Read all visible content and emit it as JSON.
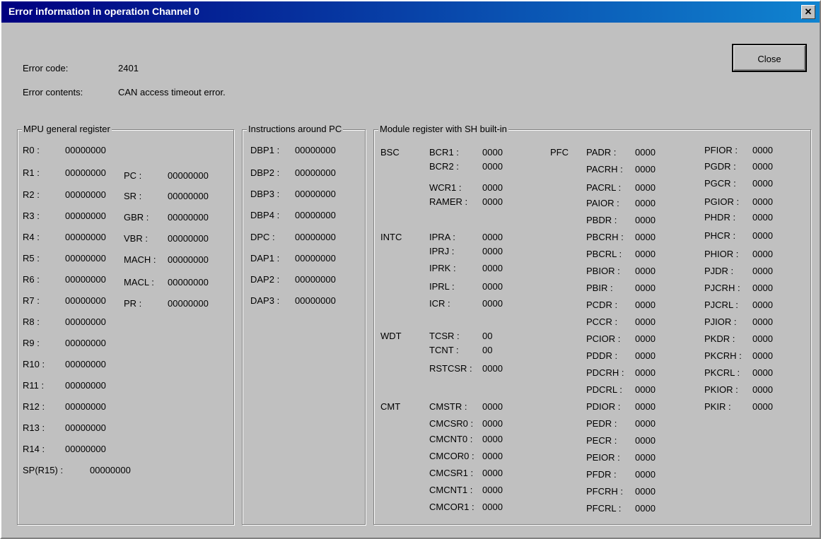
{
  "window": {
    "title": "Error information in operation Channel 0",
    "close_glyph": "✕"
  },
  "header": {
    "error_code_label": "Error code:",
    "error_code_value": "2401",
    "error_contents_label": "Error contents:",
    "error_contents_value": "CAN access timeout error.",
    "close_label": "Close"
  },
  "groups": {
    "mpu": "MPU general register",
    "instructions": "Instructions around PC",
    "module": "Module register with SH built-in"
  },
  "mpu_registers": [
    {
      "name": "R0 :",
      "value": "00000000"
    },
    {
      "name": "R1 :",
      "value": "00000000"
    },
    {
      "name": "R2 :",
      "value": "00000000"
    },
    {
      "name": "R3 :",
      "value": "00000000"
    },
    {
      "name": "R4 :",
      "value": "00000000"
    },
    {
      "name": "R5 :",
      "value": "00000000"
    },
    {
      "name": "R6 :",
      "value": "00000000"
    },
    {
      "name": "R7 :",
      "value": "00000000"
    },
    {
      "name": "R8 :",
      "value": "00000000"
    },
    {
      "name": "R9 :",
      "value": "00000000"
    },
    {
      "name": "R10 :",
      "value": "00000000"
    },
    {
      "name": "R11 :",
      "value": "00000000"
    },
    {
      "name": "R12 :",
      "value": "00000000"
    },
    {
      "name": "R13 :",
      "value": "00000000"
    },
    {
      "name": "R14 :",
      "value": "00000000"
    },
    {
      "name": "SP(R15) :",
      "value": "00000000"
    }
  ],
  "control_registers": [
    {
      "name": "PC :",
      "value": "00000000"
    },
    {
      "name": "SR :",
      "value": "00000000"
    },
    {
      "name": "GBR :",
      "value": "00000000"
    },
    {
      "name": "VBR :",
      "value": "00000000"
    },
    {
      "name": "MACH :",
      "value": "00000000"
    },
    {
      "name": "MACL :",
      "value": "00000000"
    },
    {
      "name": "PR :",
      "value": "00000000"
    }
  ],
  "instructions": [
    {
      "name": "DBP1 :",
      "value": "00000000"
    },
    {
      "name": "DBP2 :",
      "value": "00000000"
    },
    {
      "name": "DBP3 :",
      "value": "00000000"
    },
    {
      "name": "DBP4 :",
      "value": "00000000"
    },
    {
      "name": "DPC :",
      "value": "00000000"
    },
    {
      "name": "DAP1 :",
      "value": "00000000"
    },
    {
      "name": "DAP2 :",
      "value": "00000000"
    },
    {
      "name": "DAP3 :",
      "value": "00000000"
    }
  ],
  "module_sections": [
    "BSC",
    "INTC",
    "WDT",
    "CMT",
    "PFC"
  ],
  "module_col1": [
    {
      "name": "BCR1 :",
      "value": "0000"
    },
    {
      "name": "BCR2 :",
      "value": "0000"
    },
    {
      "name": "WCR1 :",
      "value": "0000"
    },
    {
      "name": "RAMER :",
      "value": "0000"
    },
    {
      "name": "IPRA :",
      "value": "0000"
    },
    {
      "name": "IPRJ :",
      "value": "0000"
    },
    {
      "name": "IPRK :",
      "value": "0000"
    },
    {
      "name": "IPRL :",
      "value": "0000"
    },
    {
      "name": "ICR :",
      "value": "0000"
    },
    {
      "name": "TCSR :",
      "value": "00"
    },
    {
      "name": "TCNT :",
      "value": "00"
    },
    {
      "name": "RSTCSR :",
      "value": "0000"
    },
    {
      "name": "CMSTR :",
      "value": "0000"
    },
    {
      "name": "CMCSR0 :",
      "value": "0000"
    },
    {
      "name": "CMCNT0 :",
      "value": "0000"
    },
    {
      "name": "CMCOR0 :",
      "value": "0000"
    },
    {
      "name": "CMCSR1 :",
      "value": "0000"
    },
    {
      "name": "CMCNT1 :",
      "value": "0000"
    },
    {
      "name": "CMCOR1 :",
      "value": "0000"
    }
  ],
  "module_col2": [
    {
      "name": "PADR :",
      "value": "0000"
    },
    {
      "name": "PACRH :",
      "value": "0000"
    },
    {
      "name": "PACRL :",
      "value": "0000"
    },
    {
      "name": "PAIOR :",
      "value": "0000"
    },
    {
      "name": "PBDR :",
      "value": "0000"
    },
    {
      "name": "PBCRH :",
      "value": "0000"
    },
    {
      "name": "PBCRL :",
      "value": "0000"
    },
    {
      "name": "PBIOR :",
      "value": "0000"
    },
    {
      "name": "PBIR :",
      "value": "0000"
    },
    {
      "name": "PCDR :",
      "value": "0000"
    },
    {
      "name": "PCCR :",
      "value": "0000"
    },
    {
      "name": "PCIOR :",
      "value": "0000"
    },
    {
      "name": "PDDR :",
      "value": "0000"
    },
    {
      "name": "PDCRH :",
      "value": "0000"
    },
    {
      "name": "PDCRL :",
      "value": "0000"
    },
    {
      "name": "PDIOR :",
      "value": "0000"
    },
    {
      "name": "PEDR :",
      "value": "0000"
    },
    {
      "name": "PECR :",
      "value": "0000"
    },
    {
      "name": "PEIOR :",
      "value": "0000"
    },
    {
      "name": "PFDR :",
      "value": "0000"
    },
    {
      "name": "PFCRH :",
      "value": "0000"
    },
    {
      "name": "PFCRL :",
      "value": "0000"
    }
  ],
  "module_col3": [
    {
      "name": "PFIOR :",
      "value": "0000"
    },
    {
      "name": "PGDR :",
      "value": "0000"
    },
    {
      "name": "PGCR :",
      "value": "0000"
    },
    {
      "name": "PGIOR :",
      "value": "0000"
    },
    {
      "name": "PHDR :",
      "value": "0000"
    },
    {
      "name": "PHCR :",
      "value": "0000"
    },
    {
      "name": "PHIOR :",
      "value": "0000"
    },
    {
      "name": "PJDR :",
      "value": "0000"
    },
    {
      "name": "PJCRH :",
      "value": "0000"
    },
    {
      "name": "PJCRL :",
      "value": "0000"
    },
    {
      "name": "PJIOR :",
      "value": "0000"
    },
    {
      "name": "PKDR :",
      "value": "0000"
    },
    {
      "name": "PKCRH :",
      "value": "0000"
    },
    {
      "name": "PKCRL :",
      "value": "0000"
    },
    {
      "name": "PKIOR :",
      "value": "0000"
    },
    {
      "name": "PKIR :",
      "value": "0000"
    }
  ]
}
